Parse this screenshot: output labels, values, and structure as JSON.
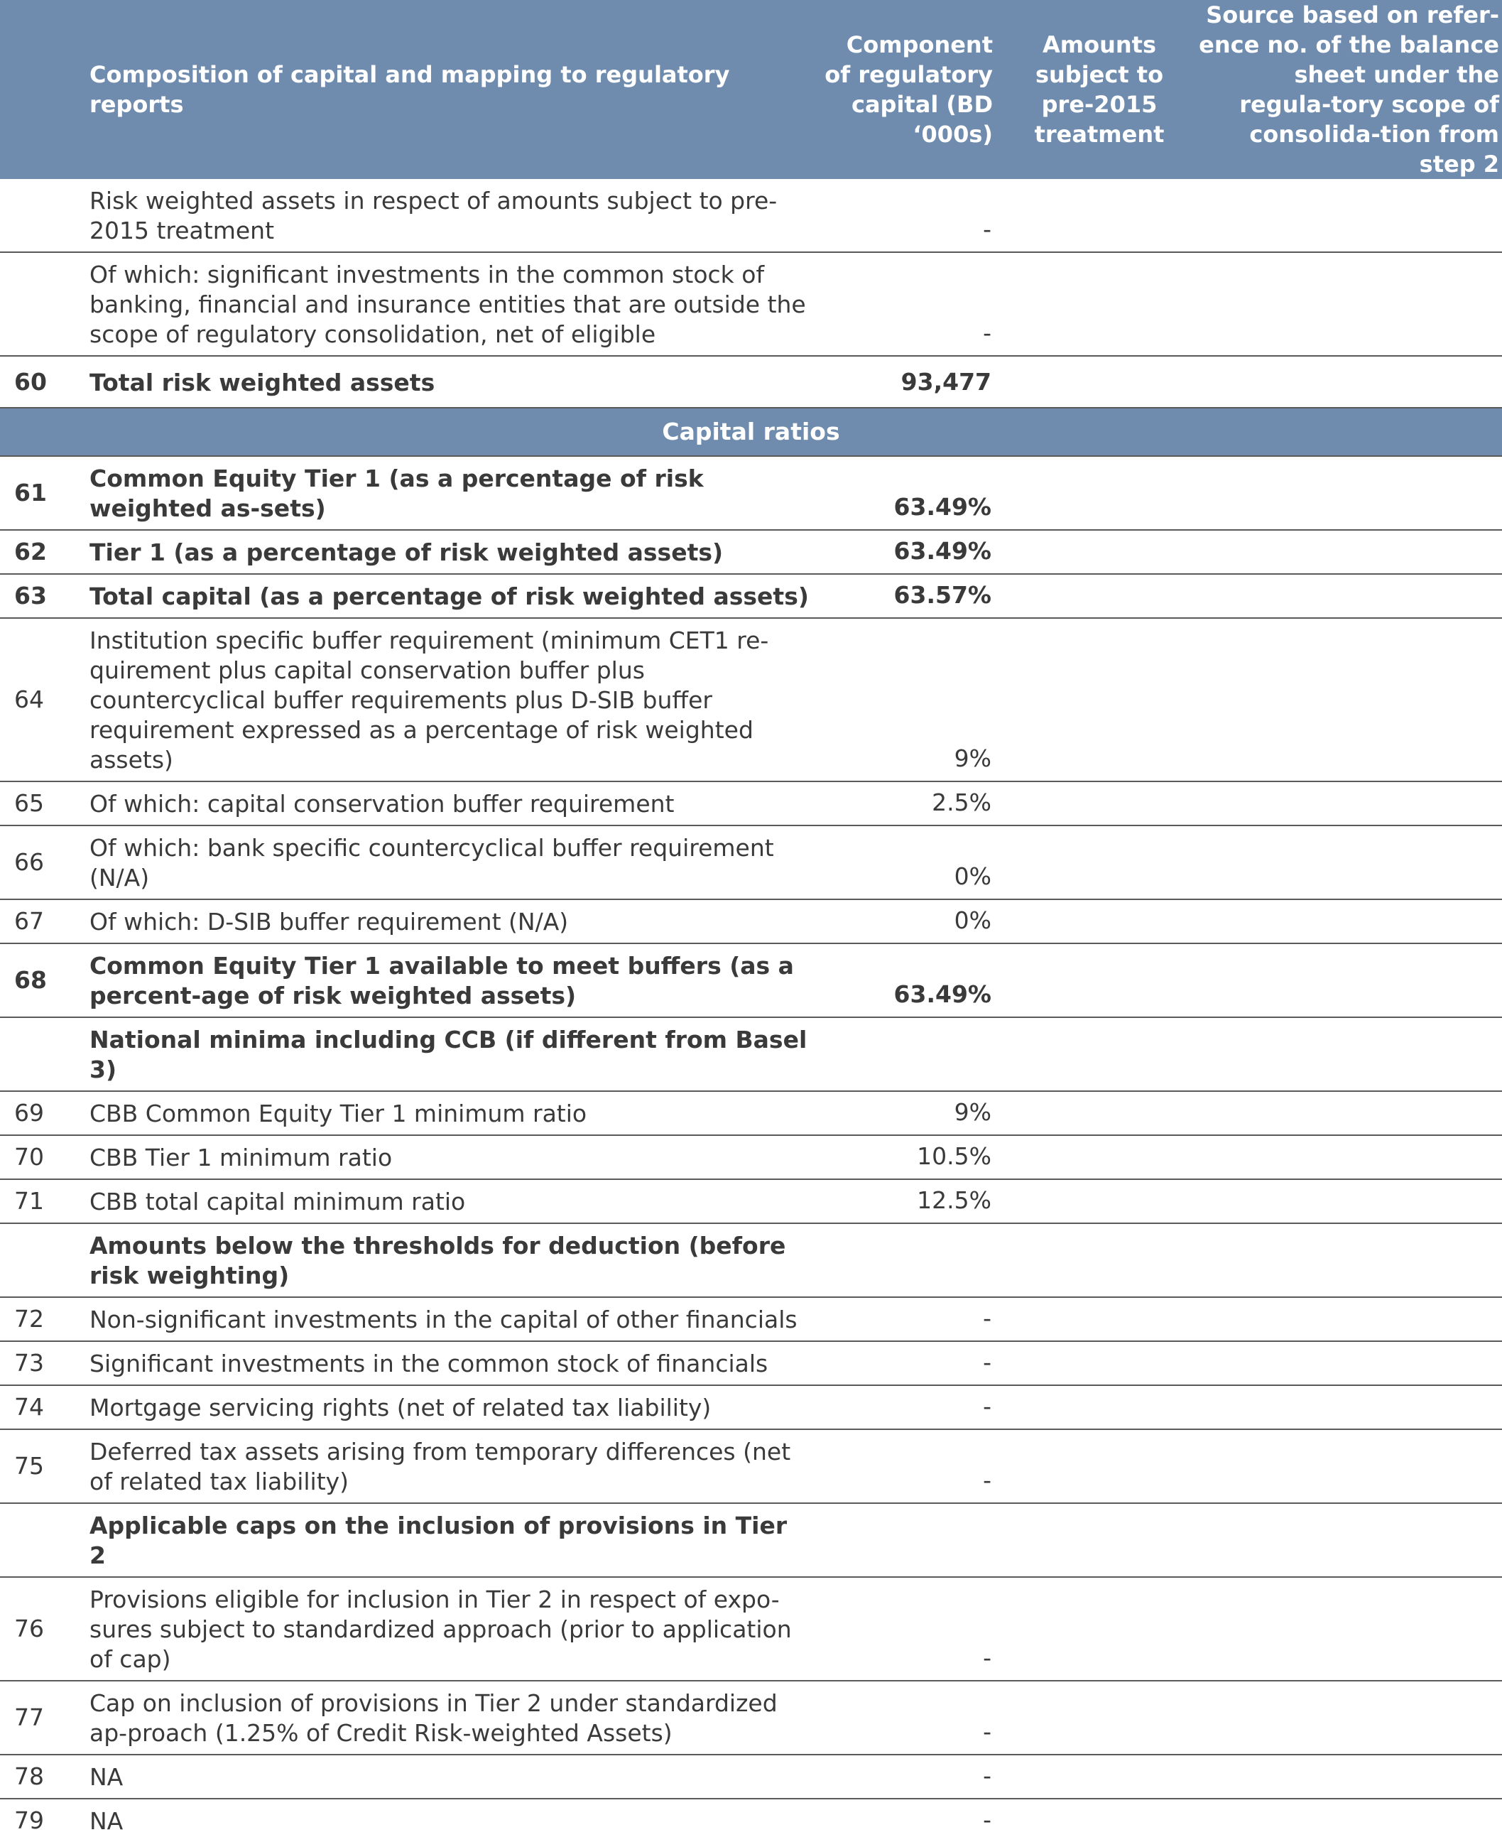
{
  "header": {
    "description": "Composition of capital and mapping to regulatory reports",
    "component": "Component of regulatory capital (BD ‘000s)",
    "amounts": "Amounts subject to pre-2015 treatment",
    "source": "Source based on refer-ence no. of the balance sheet under the regula-tory scope of consolida-tion from step 2"
  },
  "rows_a": [
    {
      "num": "",
      "desc": "Risk weighted assets in respect of amounts subject to pre-2015 treatment",
      "value": "-"
    },
    {
      "num": "",
      "desc": "Of which: significant investments in the common stock of banking, financial and insurance entities that are outside the scope of regulatory consolidation, net of eligible",
      "value": "-"
    },
    {
      "num": "60",
      "desc": "Total risk weighted assets",
      "value": "93,477"
    }
  ],
  "section": {
    "label": "Capital ratios"
  },
  "rows_b": [
    {
      "num": "61",
      "desc": "Common Equity Tier 1 (as a percentage of risk weighted as-sets)",
      "value": "63.49%"
    },
    {
      "num": "62",
      "desc": "Tier 1 (as a percentage of risk weighted assets)",
      "value": "63.49%"
    },
    {
      "num": "63",
      "desc": "Total capital (as a percentage of risk weighted assets)",
      "value": "63.57%"
    },
    {
      "num": "64",
      "desc": "Institution specific buffer requirement (minimum CET1 re-quirement plus capital conservation buffer plus countercyclical buffer requirements plus D-SIB buffer requirement expressed as a percentage of risk weighted assets)",
      "value": "9%"
    },
    {
      "num": "65",
      "desc": "Of which: capital conservation buffer requirement",
      "value": "2.5%"
    },
    {
      "num": "66",
      "desc": "Of which: bank specific countercyclical buffer requirement (N/A)",
      "value": "0%"
    },
    {
      "num": "67",
      "desc": "Of which: D-SIB buffer requirement (N/A)",
      "value": "0%"
    },
    {
      "num": "68",
      "desc": "Common Equity Tier 1 available to meet buffers (as a percent-age of risk weighted assets)",
      "value": "63.49%"
    },
    {
      "num": "",
      "desc": "National minima including CCB (if different from Basel 3)",
      "value": ""
    },
    {
      "num": "69",
      "desc": "CBB Common Equity Tier 1 minimum ratio",
      "value": "9%"
    },
    {
      "num": "70",
      "desc": "CBB Tier 1 minimum ratio",
      "value": "10.5%"
    },
    {
      "num": "71",
      "desc": "CBB total capital minimum ratio",
      "value": "12.5%"
    },
    {
      "num": "",
      "desc": "Amounts below the thresholds for deduction (before risk weighting)",
      "value": ""
    },
    {
      "num": "72",
      "desc": "Non-significant investments in the capital of other financials",
      "value": "-"
    },
    {
      "num": "73",
      "desc": "Significant investments in the common stock of financials",
      "value": "-"
    },
    {
      "num": "74",
      "desc": "Mortgage servicing rights (net of related tax liability)",
      "value": "-"
    },
    {
      "num": "75",
      "desc": "Deferred tax assets arising from temporary differences (net of related tax liability)",
      "value": "-"
    },
    {
      "num": "",
      "desc": "Applicable caps on the inclusion of provisions in Tier 2",
      "value": ""
    },
    {
      "num": "76",
      "desc": "Provisions eligible for inclusion in Tier 2 in respect of expo-sures subject to standardized approach (prior to application of cap)",
      "value": "-"
    },
    {
      "num": "77",
      "desc": "Cap on inclusion of provisions in Tier 2 under standardized ap-proach (1.25% of Credit Risk-weighted Assets)",
      "value": "-"
    },
    {
      "num": "78",
      "desc": "NA",
      "value": "-"
    },
    {
      "num": "79",
      "desc": "NA",
      "value": "-"
    }
  ]
}
